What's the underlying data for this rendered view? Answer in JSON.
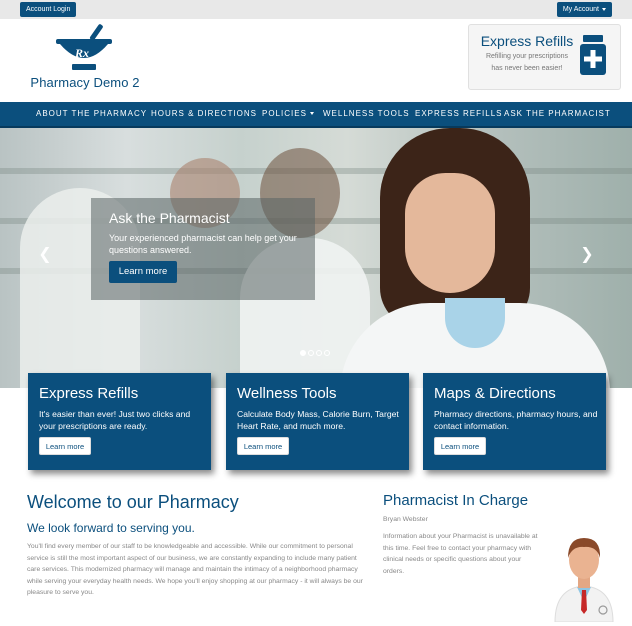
{
  "topbar": {
    "login_label": "Account Login",
    "account_label": "My Account"
  },
  "header": {
    "logo_text": "Pharmacy Demo 2",
    "express_title": "Express Refills",
    "express_sub_line1": "Refilling your prescriptions",
    "express_sub_line2": "has never been easier!"
  },
  "nav": {
    "items": [
      "ABOUT THE PHARMACY",
      "HOURS & DIRECTIONS",
      "POLICIES",
      "WELLNESS TOOLS",
      "EXPRESS REFILLS",
      "ASK THE PHARMACIST"
    ]
  },
  "hero": {
    "title": "Ask the Pharmacist",
    "text": "Your experienced pharmacist can help get your questions answered.",
    "button": "Learn more"
  },
  "cards": [
    {
      "title": "Express Refills",
      "text": "It's easier than ever! Just two clicks and your prescriptions are ready.",
      "button": "Learn more"
    },
    {
      "title": "Wellness Tools",
      "text": "Calculate Body Mass, Calorie Burn, Target Heart Rate, and much more.",
      "button": "Learn more"
    },
    {
      "title": "Maps & Directions",
      "text": "Pharmacy directions, pharmacy hours, and contact information.",
      "button": "Learn more"
    }
  ],
  "welcome": {
    "title": "Welcome to our Pharmacy",
    "subtitle": "We look forward to serving you.",
    "body": "You'll find every member of our staff to be knowledgeable and accessible. While our commitment to personal service is still the most important aspect of our business, we are constantly expanding to include many patient care services. This modernized pharmacy will manage and maintain the intimacy of a neighborhood pharmacy while serving your everyday health needs. We hope you'll enjoy shopping at our pharmacy - it will always be our pleasure to serve you."
  },
  "pharmacist": {
    "title": "Pharmacist In Charge",
    "name": "Bryan Webster",
    "body": "Information about your Pharmacist is unavailable at this time. Feel free to contact your pharmacy with clinical needs or specific questions about your orders."
  },
  "colors": {
    "brand": "#0b4f7d",
    "nav": "#0b4f7d"
  }
}
